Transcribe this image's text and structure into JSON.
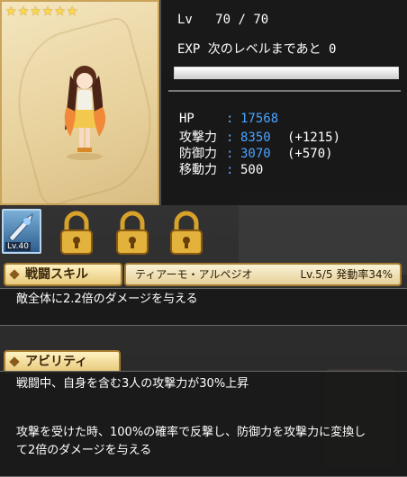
{
  "stars": 6,
  "level": {
    "label": "Lv",
    "current": "70",
    "sep": "/",
    "max": "70"
  },
  "exp": {
    "label": "EXP",
    "text": "次のレベルまであと",
    "remaining": "0",
    "progress": 1.0
  },
  "stats": {
    "hp": {
      "label": "HP",
      "value": "17568",
      "bonus": ""
    },
    "atk": {
      "label": "攻撃力",
      "value": "8350",
      "bonus": "(+1215)"
    },
    "def": {
      "label": "防御力",
      "value": "3070",
      "bonus": "(+570)"
    },
    "mov": {
      "label": "移動力",
      "value": "500",
      "bonus": ""
    }
  },
  "weapon": {
    "level": "Lv.40"
  },
  "locks": 3,
  "skill": {
    "section_label": "戦闘スキル",
    "name": "ティアーモ・アルペジオ",
    "level": "Lv.5/5",
    "rate_label": "発動率34%",
    "description": "敵全体に2.2倍のダメージを与える"
  },
  "ability": {
    "section_label": "アビリティ",
    "line1": "戦闘中、自身を含む3人の攻撃力が30%上昇",
    "line2": "攻撃を受けた時、100%の確率で反撃し、防御力を攻撃力に変換し",
    "line3": "て2倍のダメージを与える"
  }
}
